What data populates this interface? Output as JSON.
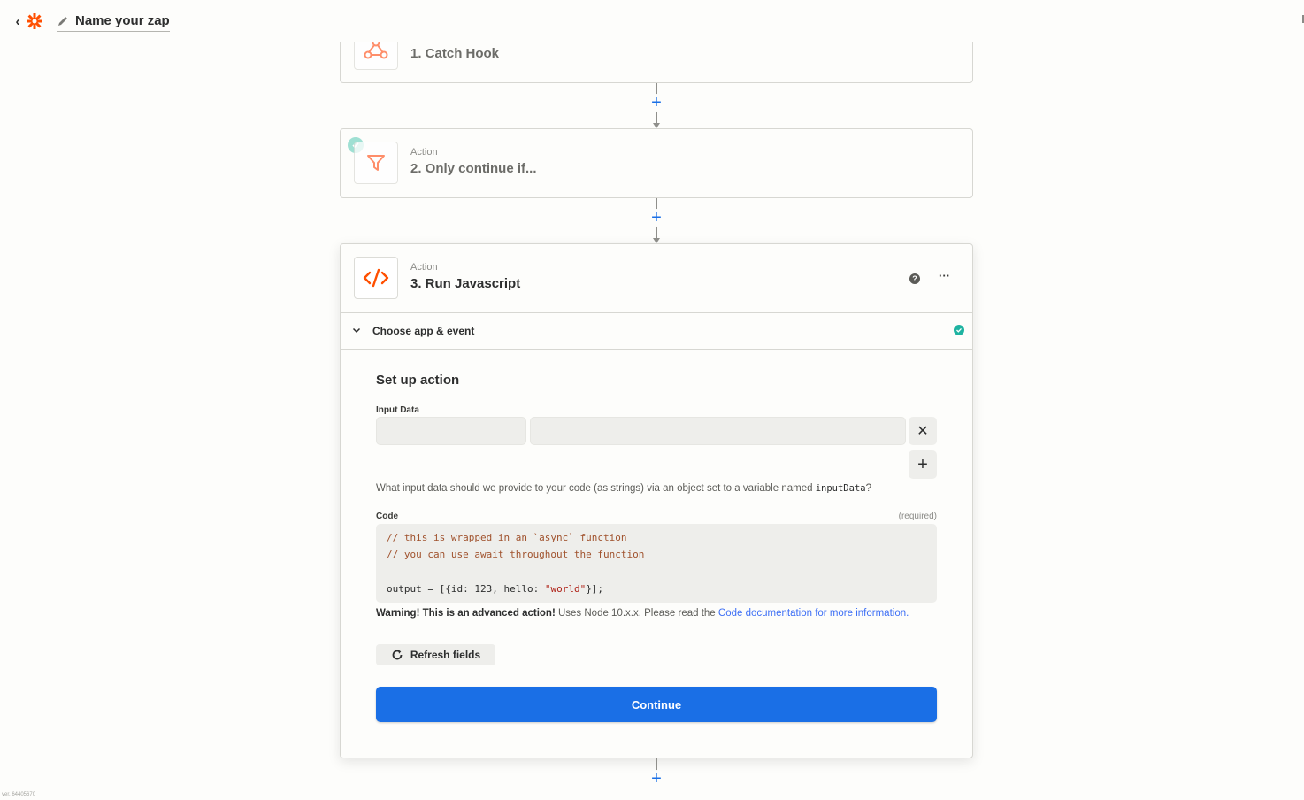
{
  "header": {
    "back_icon": "chevron-left-icon",
    "logo": "zapier-asterisk-icon",
    "zap_name": "Name your zap",
    "brand_color": "#ff4f00"
  },
  "steps": [
    {
      "kind": "",
      "title": "1. Catch Hook",
      "icon": "webhook-icon"
    },
    {
      "kind": "Action",
      "title": "2. Only continue if...",
      "icon": "filter-icon",
      "status": "complete"
    },
    {
      "kind": "Action",
      "title": "3. Run Javascript",
      "icon": "code-icon"
    }
  ],
  "active_step": {
    "help_icon": "?",
    "more_icon": "···",
    "section_label": "Choose app & event",
    "setup_title": "Set up action",
    "input_data": {
      "label": "Input Data",
      "key_value": "",
      "value_value": "",
      "remove_icon": "✕",
      "add_icon": "+",
      "help_before": "What input data should we provide to your code (as strings) via an object set to a variable named ",
      "help_code": "inputData",
      "help_after": "?"
    },
    "code": {
      "label": "Code",
      "required": "(required)",
      "line1": "// this is wrapped in an `async` function",
      "line2": "// you can use await throughout the function",
      "line4_a": "output = [{id: ",
      "line4_num": "123",
      "line4_b": ", hello: ",
      "line4_str": "\"world\"",
      "line4_c": "}];"
    },
    "warning": {
      "bold": "Warning! This is an advanced action!",
      "text": " Uses Node 10.x.x. Please read the ",
      "link": "Code documentation for more information."
    },
    "refresh_label": "Refresh fields",
    "continue_label": "Continue"
  },
  "add_step_icon": "+",
  "version": "ver. 64405670",
  "colors": {
    "primary": "#1a6fe6",
    "success": "#1eb3a1",
    "accent": "#ff4f00"
  }
}
